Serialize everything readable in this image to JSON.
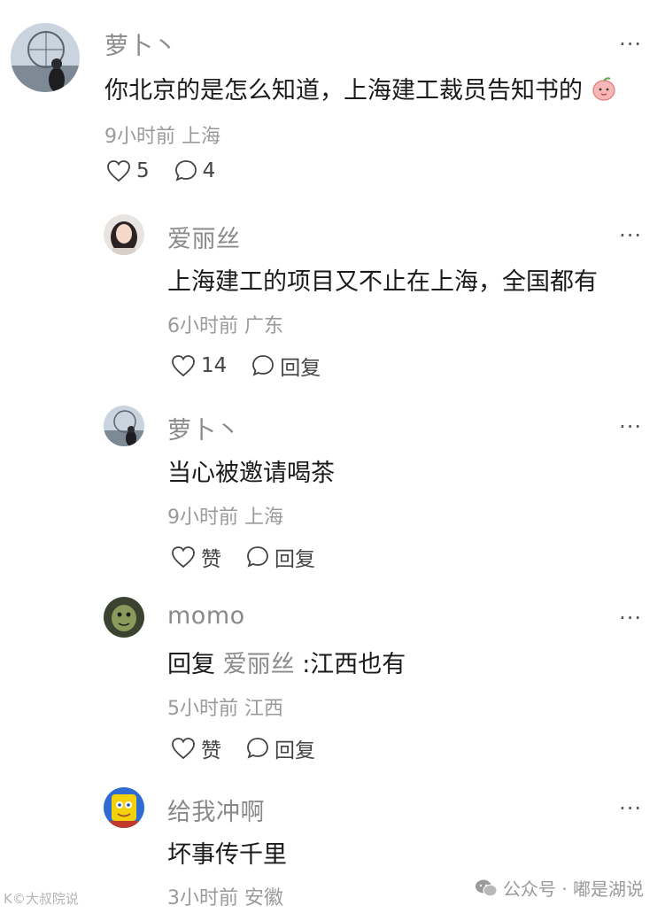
{
  "comments": [
    {
      "username": "萝卜丶",
      "text": "你北京的是怎么知道，上海建工裁员告知书的",
      "meta": "9小时前 上海",
      "like_label": "5",
      "reply_label": "4",
      "more_label": "···"
    },
    {
      "username": "爱丽丝",
      "text": "上海建工的项目又不止在上海，全国都有",
      "meta": "6小时前 广东",
      "like_label": "14",
      "reply_label": "回复",
      "more_label": "···"
    },
    {
      "username": "萝卜丶",
      "text": "当心被邀请喝茶",
      "meta": "9小时前 上海",
      "like_label": "赞",
      "reply_label": "回复",
      "more_label": "···"
    },
    {
      "username": "momo",
      "reply_prefix": "回复",
      "reply_target": "爱丽丝",
      "reply_sep": ":",
      "text": "江西也有",
      "meta": "5小时前 江西",
      "like_label": "赞",
      "reply_label": "回复",
      "more_label": "···"
    },
    {
      "username": "给我冲啊",
      "text": "坏事传千里",
      "meta": "3小时前 安徽",
      "more_label": "···"
    }
  ],
  "watermark": {
    "left": "K©大叔院说",
    "right": "公众号 · 嘟是湖说"
  }
}
